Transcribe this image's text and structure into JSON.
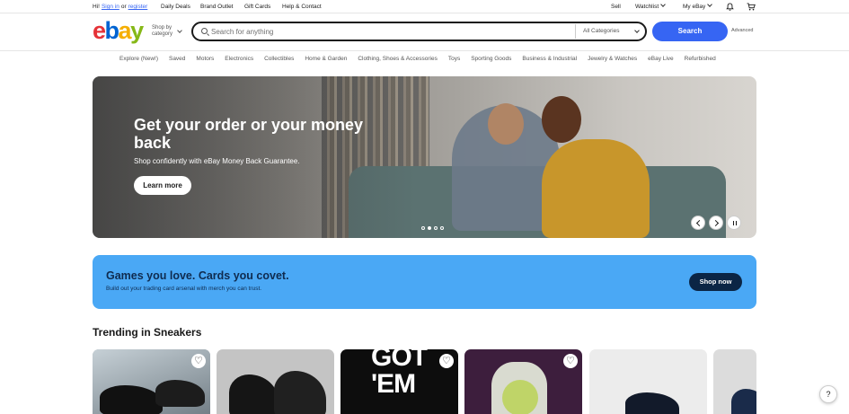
{
  "topbar": {
    "greeting": "Hi!",
    "signin": "Sign in",
    "or": "or",
    "register": "register",
    "links": [
      "Daily Deals",
      "Brand Outlet",
      "Gift Cards",
      "Help & Contact"
    ],
    "sell": "Sell",
    "watchlist": "Watchlist",
    "myebay": "My eBay"
  },
  "header": {
    "logo": [
      "e",
      "b",
      "a",
      "y"
    ],
    "shop_by_1": "Shop by",
    "shop_by_2": "category",
    "search_placeholder": "Search for anything",
    "category_select": "All Categories",
    "search_button": "Search",
    "advanced": "Advanced"
  },
  "nav": [
    "Explore (New!)",
    "Saved",
    "Motors",
    "Electronics",
    "Collectibles",
    "Home & Garden",
    "Clothing, Shoes & Accessories",
    "Toys",
    "Sporting Goods",
    "Business & Industrial",
    "Jewelry & Watches",
    "eBay Live",
    "Refurbished"
  ],
  "hero": {
    "title": "Get your order or your money back",
    "subtitle": "Shop confidently with eBay Money Back Guarantee.",
    "button": "Learn more",
    "slide_count": 4,
    "active_slide": 2
  },
  "promo": {
    "title": "Games you love. Cards you covet.",
    "subtitle": "Build out your trading card arsenal with merch you can trust.",
    "button": "Shop now"
  },
  "trending": {
    "title": "Trending in Sneakers",
    "card_text": [
      "GOT",
      "'EM"
    ]
  },
  "help": "?",
  "colors": {
    "accent": "#3665f3",
    "promo_bg": "#4aa8f5",
    "promo_btn": "#0b2545",
    "logo_e": "#e53238",
    "logo_b": "#0064d2",
    "logo_a": "#f5af02",
    "logo_y": "#86b817"
  },
  "icons": [
    "bell-icon",
    "cart-icon",
    "search-icon",
    "heart-icon",
    "help-icon"
  ]
}
